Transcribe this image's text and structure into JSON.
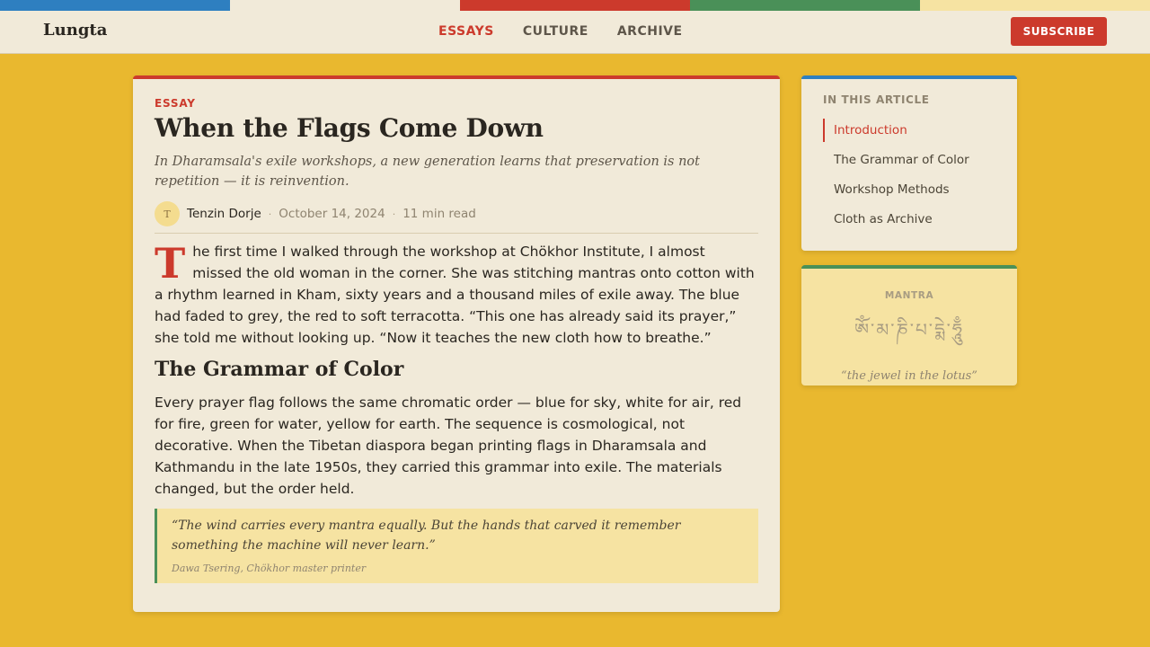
{
  "colors": {
    "flag_blue": "#2e7fc0",
    "flag_white": "#f1ead9",
    "flag_red": "#cc3a2c",
    "flag_green": "#4a9058",
    "flag_yellow": "#f6e3a2",
    "background": "#e9b82f"
  },
  "nav": {
    "logo": "Lungta",
    "links": [
      "ESSAYS",
      "CULTURE",
      "ARCHIVE"
    ],
    "active_link": "ESSAYS",
    "subscribe_label": "SUBSCRIBE"
  },
  "article": {
    "kicker": "ESSAY",
    "title": "When the Flags Come Down",
    "dek": "In Dharamsala's exile workshops, a new generation learns that preservation is not repetition — it is reinvention.",
    "author_initial": "T",
    "author": "Tenzin Dorje",
    "date": "October 14, 2024",
    "read_time": "11 min read",
    "separator": "·",
    "dropcap": "T",
    "p1": "he first time I walked through the workshop at Chökhor Institute, I almost missed the old woman in the corner. She was stitching mantras onto cotton with a rhythm learned in Kham, sixty years and a thousand miles of exile away. The blue had faded to grey, the red to soft terracotta. “This one has already said its prayer,” she told me without looking up. “Now it teaches the new cloth how to breathe.”",
    "h2": "The Grammar of Color",
    "p2": "Every prayer flag follows the same chromatic order — blue for sky, white for air, red for fire, green for water, yellow for earth. The sequence is cosmological, not decorative. When the Tibetan diaspora began printing flags in Dharamsala and Kathmandu in the late 1950s, they carried this grammar into exile. The materials changed, but the order held.",
    "quote": "“The wind carries every mantra equally. But the hands that carved it remember something the machine will never learn.”",
    "quote_cite": "Dawa Tsering, Chökhor master printer"
  },
  "toc": {
    "heading": "IN THIS ARTICLE",
    "items": [
      {
        "label": "Introduction",
        "active": true
      },
      {
        "label": "The Grammar of Color",
        "active": false
      },
      {
        "label": "Workshop Methods",
        "active": false
      },
      {
        "label": "Cloth as Archive",
        "active": false
      }
    ]
  },
  "mantra": {
    "heading": "MANTRA",
    "script": "ཨོཾ་མ་ཎི་པ་དྨེ་ཧཱུྃ",
    "translation": "“the jewel in the lotus”"
  }
}
